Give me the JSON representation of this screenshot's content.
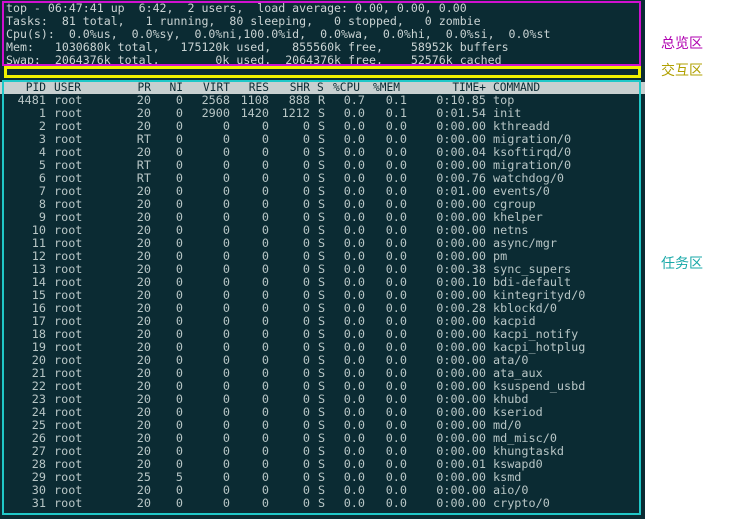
{
  "summary": {
    "line1": "top - 06:47:41 up  6:42,  2 users,  load average: 0.00, 0.00, 0.00",
    "line2": "Tasks:  81 total,   1 running,  80 sleeping,   0 stopped,   0 zombie",
    "line3": "Cpu(s):  0.0%us,  0.0%sy,  0.0%ni,100.0%id,  0.0%wa,  0.0%hi,  0.0%si,  0.0%st",
    "line4": "Mem:   1030680k total,   175120k used,   855560k free,    58952k buffers",
    "line5": "Swap:  2064376k total,        0k used,  2064376k free,    52576k cached"
  },
  "columns": [
    "PID",
    "USER",
    "PR",
    "NI",
    "VIRT",
    "RES",
    "SHR",
    "S",
    "%CPU",
    "%MEM",
    "TIME+",
    "COMMAND"
  ],
  "processes": [
    [
      "4481",
      "root",
      "20",
      "0",
      "2568",
      "1108",
      "888",
      "R",
      "0.7",
      "0.1",
      "0:10.85",
      "top"
    ],
    [
      "1",
      "root",
      "20",
      "0",
      "2900",
      "1420",
      "1212",
      "S",
      "0.0",
      "0.1",
      "0:01.54",
      "init"
    ],
    [
      "2",
      "root",
      "20",
      "0",
      "0",
      "0",
      "0",
      "S",
      "0.0",
      "0.0",
      "0:00.00",
      "kthreadd"
    ],
    [
      "3",
      "root",
      "RT",
      "0",
      "0",
      "0",
      "0",
      "S",
      "0.0",
      "0.0",
      "0:00.00",
      "migration/0"
    ],
    [
      "4",
      "root",
      "20",
      "0",
      "0",
      "0",
      "0",
      "S",
      "0.0",
      "0.0",
      "0:00.04",
      "ksoftirqd/0"
    ],
    [
      "5",
      "root",
      "RT",
      "0",
      "0",
      "0",
      "0",
      "S",
      "0.0",
      "0.0",
      "0:00.00",
      "migration/0"
    ],
    [
      "6",
      "root",
      "RT",
      "0",
      "0",
      "0",
      "0",
      "S",
      "0.0",
      "0.0",
      "0:00.76",
      "watchdog/0"
    ],
    [
      "7",
      "root",
      "20",
      "0",
      "0",
      "0",
      "0",
      "S",
      "0.0",
      "0.0",
      "0:01.00",
      "events/0"
    ],
    [
      "8",
      "root",
      "20",
      "0",
      "0",
      "0",
      "0",
      "S",
      "0.0",
      "0.0",
      "0:00.00",
      "cgroup"
    ],
    [
      "9",
      "root",
      "20",
      "0",
      "0",
      "0",
      "0",
      "S",
      "0.0",
      "0.0",
      "0:00.00",
      "khelper"
    ],
    [
      "10",
      "root",
      "20",
      "0",
      "0",
      "0",
      "0",
      "S",
      "0.0",
      "0.0",
      "0:00.00",
      "netns"
    ],
    [
      "11",
      "root",
      "20",
      "0",
      "0",
      "0",
      "0",
      "S",
      "0.0",
      "0.0",
      "0:00.00",
      "async/mgr"
    ],
    [
      "12",
      "root",
      "20",
      "0",
      "0",
      "0",
      "0",
      "S",
      "0.0",
      "0.0",
      "0:00.00",
      "pm"
    ],
    [
      "13",
      "root",
      "20",
      "0",
      "0",
      "0",
      "0",
      "S",
      "0.0",
      "0.0",
      "0:00.38",
      "sync_supers"
    ],
    [
      "14",
      "root",
      "20",
      "0",
      "0",
      "0",
      "0",
      "S",
      "0.0",
      "0.0",
      "0:00.10",
      "bdi-default"
    ],
    [
      "15",
      "root",
      "20",
      "0",
      "0",
      "0",
      "0",
      "S",
      "0.0",
      "0.0",
      "0:00.00",
      "kintegrityd/0"
    ],
    [
      "16",
      "root",
      "20",
      "0",
      "0",
      "0",
      "0",
      "S",
      "0.0",
      "0.0",
      "0:00.28",
      "kblockd/0"
    ],
    [
      "17",
      "root",
      "20",
      "0",
      "0",
      "0",
      "0",
      "S",
      "0.0",
      "0.0",
      "0:00.00",
      "kacpid"
    ],
    [
      "18",
      "root",
      "20",
      "0",
      "0",
      "0",
      "0",
      "S",
      "0.0",
      "0.0",
      "0:00.00",
      "kacpi_notify"
    ],
    [
      "19",
      "root",
      "20",
      "0",
      "0",
      "0",
      "0",
      "S",
      "0.0",
      "0.0",
      "0:00.00",
      "kacpi_hotplug"
    ],
    [
      "20",
      "root",
      "20",
      "0",
      "0",
      "0",
      "0",
      "S",
      "0.0",
      "0.0",
      "0:00.00",
      "ata/0"
    ],
    [
      "21",
      "root",
      "20",
      "0",
      "0",
      "0",
      "0",
      "S",
      "0.0",
      "0.0",
      "0:00.00",
      "ata_aux"
    ],
    [
      "22",
      "root",
      "20",
      "0",
      "0",
      "0",
      "0",
      "S",
      "0.0",
      "0.0",
      "0:00.00",
      "ksuspend_usbd"
    ],
    [
      "23",
      "root",
      "20",
      "0",
      "0",
      "0",
      "0",
      "S",
      "0.0",
      "0.0",
      "0:00.00",
      "khubd"
    ],
    [
      "24",
      "root",
      "20",
      "0",
      "0",
      "0",
      "0",
      "S",
      "0.0",
      "0.0",
      "0:00.00",
      "kseriod"
    ],
    [
      "25",
      "root",
      "20",
      "0",
      "0",
      "0",
      "0",
      "S",
      "0.0",
      "0.0",
      "0:00.00",
      "md/0"
    ],
    [
      "26",
      "root",
      "20",
      "0",
      "0",
      "0",
      "0",
      "S",
      "0.0",
      "0.0",
      "0:00.00",
      "md_misc/0"
    ],
    [
      "27",
      "root",
      "20",
      "0",
      "0",
      "0",
      "0",
      "S",
      "0.0",
      "0.0",
      "0:00.00",
      "khungtaskd"
    ],
    [
      "28",
      "root",
      "20",
      "0",
      "0",
      "0",
      "0",
      "S",
      "0.0",
      "0.0",
      "0:00.01",
      "kswapd0"
    ],
    [
      "29",
      "root",
      "25",
      "5",
      "0",
      "0",
      "0",
      "S",
      "0.0",
      "0.0",
      "0:00.00",
      "ksmd"
    ],
    [
      "30",
      "root",
      "20",
      "0",
      "0",
      "0",
      "0",
      "S",
      "0.0",
      "0.0",
      "0:00.00",
      "aio/0"
    ],
    [
      "31",
      "root",
      "20",
      "0",
      "0",
      "0",
      "0",
      "S",
      "0.0",
      "0.0",
      "0:00.00",
      "crypto/0"
    ]
  ],
  "annotations": {
    "summary_label": "总览区",
    "interactive_label": "交互区",
    "tasks_label": "任务区"
  },
  "colors": {
    "terminal_bg": "#0b2b33",
    "terminal_text": "#b8c6c6",
    "header_bar": "#c8d0d0",
    "summary_frame": "#d010d0",
    "interactive_frame": "#f0f000",
    "tasks_frame": "#20c8c8"
  }
}
